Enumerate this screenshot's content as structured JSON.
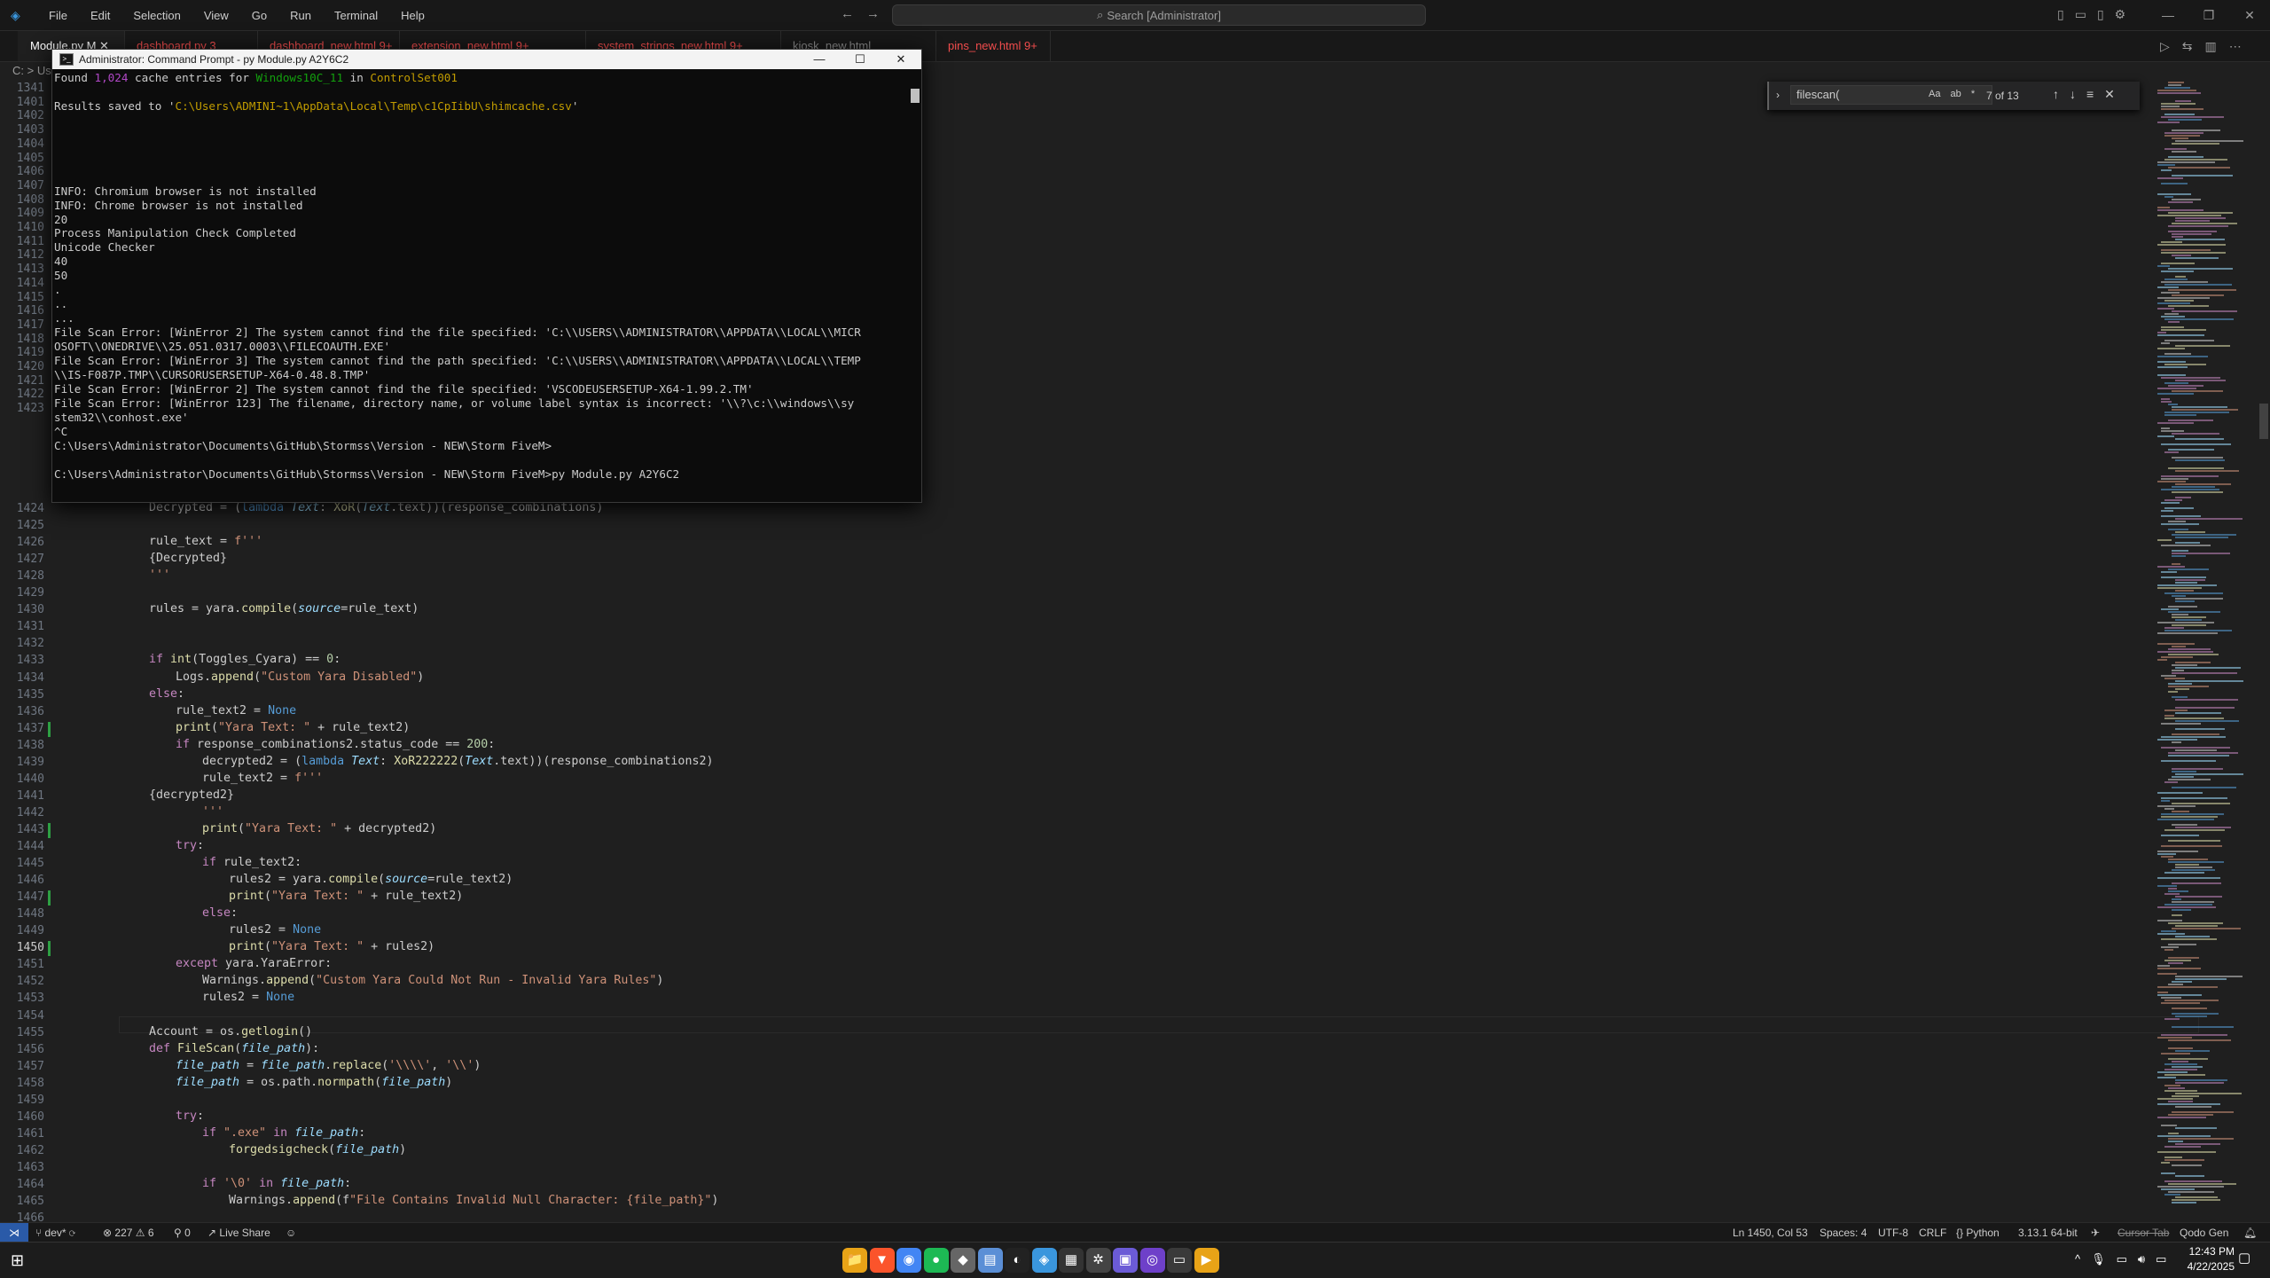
{
  "menu": [
    "File",
    "Edit",
    "Selection",
    "View",
    "Go",
    "Run",
    "Terminal",
    "Help"
  ],
  "command_center": "Search [Administrator]",
  "window_controls": [
    "—",
    "❐",
    "✕"
  ],
  "tabs": [
    {
      "label": "Module.py M",
      "active": true
    },
    {
      "label": "dashboard.py 3",
      "active": false
    },
    {
      "label": "dashboard_new.html 9+",
      "active": false
    },
    {
      "label": "extension_new.html 9+",
      "active": false
    },
    {
      "label": "system_strings_new.html 9+",
      "active": false
    },
    {
      "label": "kiosk_new.html",
      "active": false
    },
    {
      "label": "pins_new.html 9+",
      "active": false
    }
  ],
  "breadcrumb": "C: > Us",
  "find": {
    "query": "filescan(",
    "count": "7 of 13",
    "opts": [
      "Aa",
      "ab",
      "*"
    ]
  },
  "cmd": {
    "title": "Administrator: Command Prompt - py  Module.py A2Y6C2",
    "lines": [
      "Found 1,024 cache entries for Windows10C_11 in ControlSet001",
      "",
      "Results saved to 'C:\\Users\\ADMINI~1\\AppData\\Local\\Temp\\c1CpIibU\\shimcache.csv'",
      "",
      "",
      "",
      "",
      "",
      "INFO: Chromium browser is not installed",
      "INFO: Chrome browser is not installed",
      "20",
      "Process Manipulation Check Completed",
      "Unicode Checker",
      "40",
      "50",
      ".",
      "..",
      "...",
      "File Scan Error: [WinError 2] The system cannot find the file specified: 'C:\\\\USERS\\\\ADMINISTRATOR\\\\APPDATA\\\\LOCAL\\\\MICR",
      "OSOFT\\\\ONEDRIVE\\\\25.051.0317.0003\\\\FILECOAUTH.EXE'",
      "File Scan Error: [WinError 3] The system cannot find the path specified: 'C:\\\\USERS\\\\ADMINISTRATOR\\\\APPDATA\\\\LOCAL\\\\TEMP",
      "\\\\IS-F087P.TMP\\\\CURSORUSERSETUP-X64-0.48.8.TMP'",
      "File Scan Error: [WinError 2] The system cannot find the file specified: 'VSCODEUSERSETUP-X64-1.99.2.TM'",
      "File Scan Error: [WinError 123] The filename, directory name, or volume label syntax is incorrect: '\\\\?\\c:\\\\windows\\\\sy",
      "stem32\\\\conhost.exe'",
      "^C",
      "C:\\Users\\Administrator\\Documents\\GitHub\\Stormss\\Version - NEW\\Storm FiveM>",
      "",
      "C:\\Users\\Administrator\\Documents\\GitHub\\Stormss\\Version - NEW\\Storm FiveM>py Module.py A2Y6C2"
    ]
  },
  "line_numbers_top": [
    "1341",
    "1401",
    "1402",
    "1403",
    "1404",
    "1405",
    "1406",
    "1407",
    "1408",
    "1409",
    "1410",
    "1411",
    "1412",
    "1413",
    "1414",
    "1415",
    "1416",
    "1417",
    "1418",
    "1419",
    "1420",
    "1421",
    "1422",
    "1423"
  ],
  "code_lines": [
    {
      "n": "1424",
      "t": "Decrypted = (lambda Text: XoR(Text.text))(response_combinations)",
      "i": 0
    },
    {
      "n": "1425",
      "t": "",
      "i": 0
    },
    {
      "n": "1426",
      "t": "rule_text = f'''",
      "i": 0
    },
    {
      "n": "1427",
      "t": "{Decrypted}",
      "i": 0
    },
    {
      "n": "1428",
      "t": "'''",
      "i": 0
    },
    {
      "n": "1429",
      "t": "",
      "i": 0
    },
    {
      "n": "1430",
      "t": "rules = yara.compile(source=rule_text)",
      "i": 0
    },
    {
      "n": "1431",
      "t": "",
      "i": 0
    },
    {
      "n": "1432",
      "t": "",
      "i": 0
    },
    {
      "n": "1433",
      "t": "if int(Toggles_Cyara) == 0:",
      "i": 0
    },
    {
      "n": "1434",
      "t": "Logs.append(\"Custom Yara Disabled\")",
      "i": 1
    },
    {
      "n": "1435",
      "t": "else:",
      "i": 0
    },
    {
      "n": "1436",
      "t": "rule_text2 = None",
      "i": 1
    },
    {
      "n": "1437",
      "t": "print(\"Yara Text: \" + rule_text2)",
      "i": 1
    },
    {
      "n": "1438",
      "t": "if response_combinations2.status_code == 200:",
      "i": 1
    },
    {
      "n": "1439",
      "t": "decrypted2 = (lambda Text: XoR222222(Text.text))(response_combinations2)",
      "i": 2
    },
    {
      "n": "1440",
      "t": "rule_text2 = f'''",
      "i": 2
    },
    {
      "n": "1441",
      "t": "{decrypted2}",
      "i": 0
    },
    {
      "n": "1442",
      "t": "'''",
      "i": 2
    },
    {
      "n": "1443",
      "t": "print(\"Yara Text: \" + decrypted2)",
      "i": 2
    },
    {
      "n": "1444",
      "t": "try:",
      "i": 1
    },
    {
      "n": "1445",
      "t": "if rule_text2:",
      "i": 2
    },
    {
      "n": "1446",
      "t": "rules2 = yara.compile(source=rule_text2)",
      "i": 3
    },
    {
      "n": "1447",
      "t": "print(\"Yara Text: \" + rule_text2)",
      "i": 3
    },
    {
      "n": "1448",
      "t": "else:",
      "i": 2
    },
    {
      "n": "1449",
      "t": "rules2 = None",
      "i": 3
    },
    {
      "n": "1450",
      "t": "print(\"Yara Text: \" + rules2)",
      "i": 3
    },
    {
      "n": "1451",
      "t": "except yara.YaraError:",
      "i": 1
    },
    {
      "n": "1452",
      "t": "Warnings.append(\"Custom Yara Could Not Run - Invalid Yara Rules\")",
      "i": 2
    },
    {
      "n": "1453",
      "t": "rules2 = None",
      "i": 2
    },
    {
      "n": "1454",
      "t": "",
      "i": 0
    },
    {
      "n": "1455",
      "t": "Account = os.getlogin()",
      "i": 0
    },
    {
      "n": "1456",
      "t": "def FileScan(file_path):",
      "i": 0
    },
    {
      "n": "1457",
      "t": "file_path = file_path.replace('\\\\\\\\', '\\\\')",
      "i": 1
    },
    {
      "n": "1458",
      "t": "file_path = os.path.normpath(file_path)",
      "i": 1
    },
    {
      "n": "1459",
      "t": "",
      "i": 0
    },
    {
      "n": "1460",
      "t": "try:",
      "i": 1
    },
    {
      "n": "1461",
      "t": "if \".exe\" in file_path:",
      "i": 2
    },
    {
      "n": "1462",
      "t": "forgedsigcheck(file_path)",
      "i": 3
    },
    {
      "n": "1463",
      "t": "",
      "i": 0
    },
    {
      "n": "1464",
      "t": "if '\\0' in file_path:",
      "i": 2
    },
    {
      "n": "1465",
      "t": "Warnings.append(f\"File Contains Invalid Null Character: {file_path}\")",
      "i": 3
    },
    {
      "n": "1466",
      "t": "",
      "i": 0
    }
  ],
  "status": {
    "branch": "dev*",
    "errors": "227",
    "warnings": "6",
    "ports": "0",
    "liveshare": "Live Share",
    "position": "Ln 1450, Col 53",
    "spaces": "Spaces: 4",
    "encoding": "UTF-8",
    "eol": "CRLF",
    "language": "Python",
    "interpreter": "3.13.1 64-bit",
    "cursortab": "Cursor Tab",
    "qodo": "Qodo Gen"
  },
  "taskbar": {
    "time": "12:43 PM",
    "date": "4/22/2025",
    "apps": [
      {
        "icon": "folder-icon",
        "glyph": "📁",
        "color": "#e8a317"
      },
      {
        "icon": "brave-icon",
        "glyph": "▼",
        "color": "#fb542b"
      },
      {
        "icon": "chrome-icon",
        "glyph": "◉",
        "color": "#4285f4"
      },
      {
        "icon": "spotify-icon",
        "glyph": "●",
        "color": "#1db954"
      },
      {
        "icon": "app-icon",
        "glyph": "◆",
        "color": "#666666"
      },
      {
        "icon": "notes-icon",
        "glyph": "▤",
        "color": "#5b8fd6"
      },
      {
        "icon": "clock-app-icon",
        "glyph": "◐",
        "color": "#222222"
      },
      {
        "icon": "vscode-taskbar-icon",
        "glyph": "◈",
        "color": "#3a96dd"
      },
      {
        "icon": "calculator-icon",
        "glyph": "▦",
        "color": "#333333"
      },
      {
        "icon": "settings-app-icon",
        "glyph": "✲",
        "color": "#444444"
      },
      {
        "icon": "photos-icon",
        "glyph": "▣",
        "color": "#6b5bd6"
      },
      {
        "icon": "github-icon",
        "glyph": "◎",
        "color": "#6e40c9"
      },
      {
        "icon": "terminal-icon",
        "glyph": "▭",
        "color": "#3a3a3a"
      },
      {
        "icon": "media-icon",
        "glyph": "▶",
        "color": "#e8a317"
      }
    ]
  }
}
